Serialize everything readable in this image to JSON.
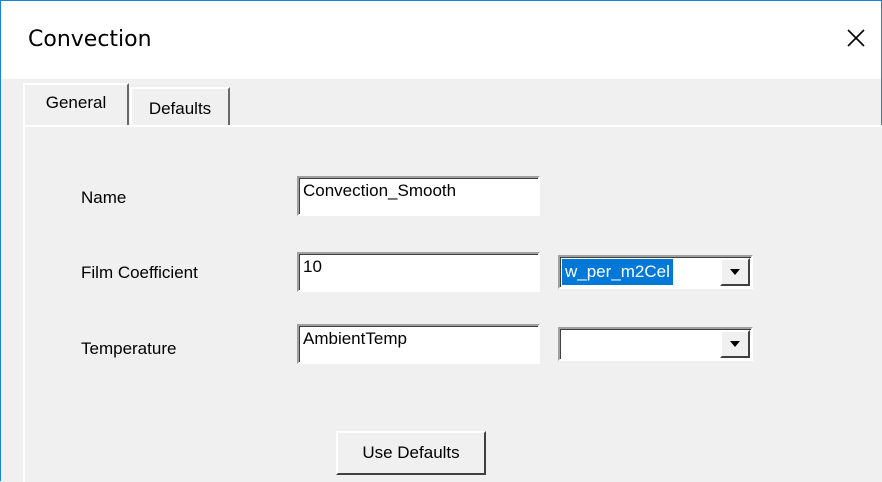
{
  "window": {
    "title": "Convection",
    "close_icon": "close-icon"
  },
  "tabs": [
    {
      "label": "General",
      "active": true
    },
    {
      "label": "Defaults",
      "active": false
    }
  ],
  "form": {
    "name": {
      "label": "Name",
      "value": "Convection_Smooth"
    },
    "film_coefficient": {
      "label": "Film Coefficient",
      "value": "10",
      "unit": "w_per_m2Cel"
    },
    "temperature": {
      "label": "Temperature",
      "value": "AmbientTemp",
      "unit": ""
    }
  },
  "buttons": {
    "use_defaults": "Use Defaults"
  },
  "colors": {
    "selection": "#0078d7",
    "window_border": "#1883d7",
    "face": "#f0f0f0"
  }
}
